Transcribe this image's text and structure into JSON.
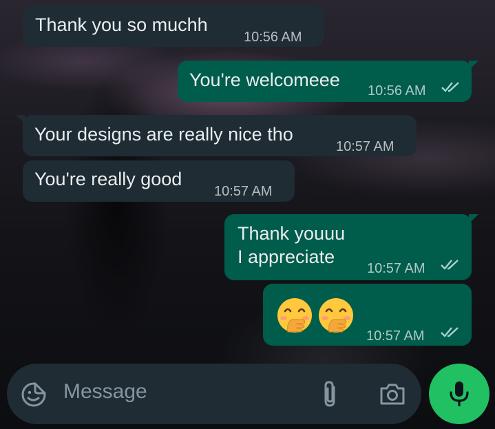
{
  "messages": [
    {
      "direction": "incoming",
      "text": "Thank you so muchh",
      "time": "10:56 AM"
    },
    {
      "direction": "outgoing",
      "text": "You're welcomeee",
      "time": "10:56 AM",
      "status": "read"
    },
    {
      "direction": "incoming",
      "text": "Your designs are really nice tho",
      "time": "10:57 AM"
    },
    {
      "direction": "incoming",
      "text": "You're really good",
      "time": "10:57 AM"
    },
    {
      "direction": "outgoing",
      "lines": [
        "Thank youuu",
        "I appreciate"
      ],
      "time": "10:57 AM",
      "status": "read"
    },
    {
      "direction": "outgoing",
      "emojis": [
        "face-with-hand-over-mouth",
        "face-with-hand-over-mouth"
      ],
      "time": "10:57 AM",
      "status": "read"
    }
  ],
  "composer": {
    "placeholder": "Message",
    "icons": [
      "sticker-icon",
      "paperclip-icon",
      "camera-icon"
    ]
  },
  "mic_button": {
    "icon": "microphone-icon"
  },
  "colors": {
    "incoming_bubble": "#1f2c33",
    "outgoing_bubble": "#005c4b",
    "mic_button": "#21c063",
    "read_ticks": "#a8d4c9"
  }
}
